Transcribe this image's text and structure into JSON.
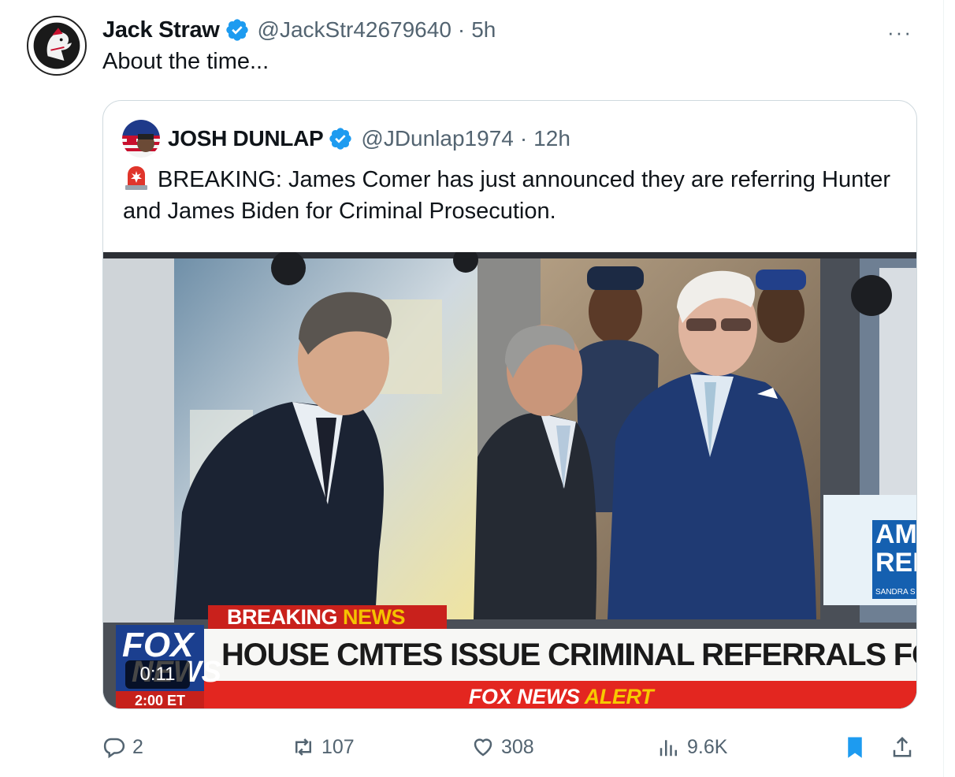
{
  "tweet": {
    "author_name": "Jack Straw",
    "handle": "@JackStr42679640",
    "separator": "·",
    "time": "5h",
    "text": "About the time...",
    "more_label": "···"
  },
  "quote": {
    "author_name": "JOSH DUNLAP",
    "handle": "@JDunlap1974",
    "separator": "·",
    "time": "12h",
    "text": "BREAKING: James Comer has just announced they are referring Hunter and James Biden for Criminal Prosecution."
  },
  "media": {
    "banner_breaking": "BREAKING",
    "banner_news": "NEWS",
    "headline": "HOUSE CMTES ISSUE CRIMINAL REFERRALS FOR BIDENS",
    "alert_prefix": "FOX NEWS",
    "alert_word": "ALERT",
    "logo_top": "FOX",
    "logo_bottom": "NEWS",
    "clock": "2:00 ET",
    "video_timer": "0:11",
    "side_promo_text": "AM REI",
    "side_promo_tag": "SANDRA S"
  },
  "actions": {
    "replies": "2",
    "reposts": "107",
    "likes": "308",
    "views": "9.6K"
  },
  "colors": {
    "verified_blue": "#1d9bf0",
    "secondary_text": "#536471",
    "fox_red": "#e32620",
    "fox_blue": "#1b3f8f",
    "alert_yellow": "#f7c900"
  }
}
